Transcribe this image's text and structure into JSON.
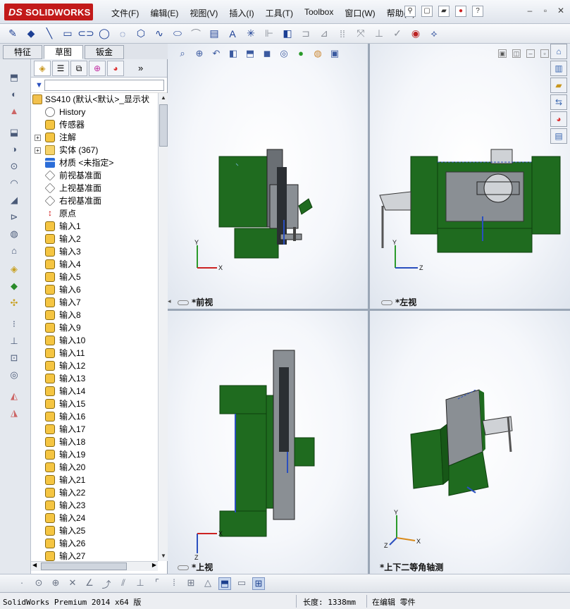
{
  "app": {
    "logo_text": "SOLIDWORKS",
    "logo_ds": "DS"
  },
  "menu": [
    "文件(F)",
    "编辑(E)",
    "视图(V)",
    "插入(I)",
    "工具(T)",
    "Toolbox",
    "窗口(W)",
    "帮助(H)"
  ],
  "tabs": [
    "特征",
    "草图",
    "钣金"
  ],
  "tree": {
    "root": "SS410  (默认<默认>_显示状",
    "items": [
      {
        "label": "History",
        "icon": "history-icon"
      },
      {
        "label": "传感器",
        "icon": "sensor-icon"
      },
      {
        "label": "注解",
        "icon": "annotation-icon",
        "expandable": true
      },
      {
        "label": "实体 (367)",
        "icon": "solid-bodies-icon",
        "expandable": true
      },
      {
        "label": "材质 <未指定>",
        "icon": "material-icon"
      },
      {
        "label": "前视基准面",
        "icon": "plane-icon"
      },
      {
        "label": "上视基准面",
        "icon": "plane-icon"
      },
      {
        "label": "右视基准面",
        "icon": "plane-icon"
      },
      {
        "label": "原点",
        "icon": "origin-icon"
      },
      {
        "label": "输入1",
        "icon": "import-icon"
      },
      {
        "label": "输入2",
        "icon": "import-icon"
      },
      {
        "label": "输入3",
        "icon": "import-icon"
      },
      {
        "label": "输入4",
        "icon": "import-icon"
      },
      {
        "label": "输入5",
        "icon": "import-icon"
      },
      {
        "label": "输入6",
        "icon": "import-icon"
      },
      {
        "label": "输入7",
        "icon": "import-icon"
      },
      {
        "label": "输入8",
        "icon": "import-icon"
      },
      {
        "label": "输入9",
        "icon": "import-icon"
      },
      {
        "label": "输入10",
        "icon": "import-icon"
      },
      {
        "label": "输入11",
        "icon": "import-icon"
      },
      {
        "label": "输入12",
        "icon": "import-icon"
      },
      {
        "label": "输入13",
        "icon": "import-icon"
      },
      {
        "label": "输入14",
        "icon": "import-icon"
      },
      {
        "label": "输入15",
        "icon": "import-icon"
      },
      {
        "label": "输入16",
        "icon": "import-icon"
      },
      {
        "label": "输入17",
        "icon": "import-icon"
      },
      {
        "label": "输入18",
        "icon": "import-icon"
      },
      {
        "label": "输入19",
        "icon": "import-icon"
      },
      {
        "label": "输入20",
        "icon": "import-icon"
      },
      {
        "label": "输入21",
        "icon": "import-icon"
      },
      {
        "label": "输入22",
        "icon": "import-icon"
      },
      {
        "label": "输入23",
        "icon": "import-icon"
      },
      {
        "label": "输入24",
        "icon": "import-icon"
      },
      {
        "label": "输入25",
        "icon": "import-icon"
      },
      {
        "label": "输入26",
        "icon": "import-icon"
      },
      {
        "label": "输入27",
        "icon": "import-icon"
      }
    ]
  },
  "views": {
    "front": "*前视",
    "left": "*左视",
    "top": "*上视",
    "iso": "*上下二等角轴测"
  },
  "axes": {
    "x": "X",
    "y": "Y",
    "z": "Z"
  },
  "status": {
    "product": "SolidWorks Premium 2014 x64 版",
    "length": "长度: 1338mm",
    "mode": "在编辑 零件"
  },
  "colors": {
    "model_green": "#1f6b1f",
    "model_dark": "#0e3f0e",
    "model_grey": "#8a8f94",
    "accent_blue": "#2a4fbf"
  }
}
